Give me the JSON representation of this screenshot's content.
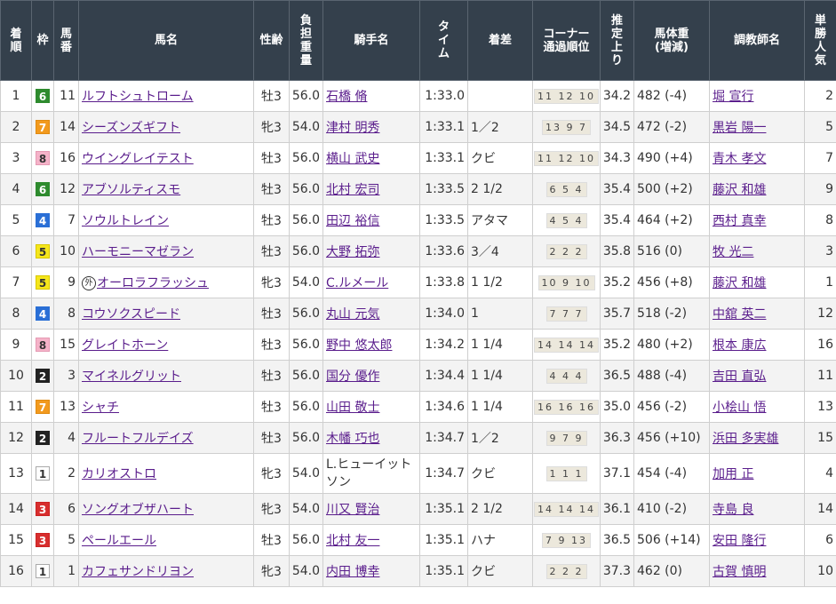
{
  "headers": {
    "rank": "着順",
    "waku": "枠",
    "umaban": "馬番",
    "horse": "馬名",
    "sexage": "性齢",
    "weight": "負担重量",
    "jockey": "騎手名",
    "time": "タイム",
    "margin": "着差",
    "corner": "コーナー通過順位",
    "last3f": "推定上り",
    "bodyweight": "馬体重(増減)",
    "trainer": "調教師名",
    "popularity": "単勝人気"
  },
  "header_lines": {
    "rank": [
      "着",
      "順"
    ],
    "umaban": [
      "馬",
      "番"
    ],
    "weight": [
      "負",
      "担",
      "重",
      "量"
    ],
    "time": [
      "タ",
      "イ",
      "ム"
    ],
    "corner": [
      "コーナー",
      "通過順位"
    ],
    "last3f": [
      "推",
      "定",
      "上",
      "り"
    ],
    "bodyweight": [
      "馬体重",
      "(増減)"
    ],
    "popularity": [
      "単",
      "勝",
      "人",
      "気"
    ]
  },
  "colors": {
    "header_bg": "#34404c",
    "link": "#5a1d8c",
    "waku_1": "#ffffff",
    "waku_2": "#222222",
    "waku_3": "#d72e2e",
    "waku_4": "#2a6fd6",
    "waku_5": "#f5e61c",
    "waku_6": "#2e8b2e",
    "waku_7": "#f29a1e",
    "waku_8": "#f5b3c9"
  },
  "rows": [
    {
      "rank": "1",
      "waku": "6",
      "umaban": "11",
      "mark": "",
      "horse": "ルフトシュトローム",
      "sexage": "牡3",
      "weight": "56.0",
      "jockey": "石橋 脩",
      "time": "1:33.0",
      "margin": "",
      "corner": "11 12 10",
      "last3f": "34.2",
      "bodyweight": "482 (-4)",
      "trainer": "堀 宣行",
      "popularity": "2"
    },
    {
      "rank": "2",
      "waku": "7",
      "umaban": "14",
      "mark": "",
      "horse": "シーズンズギフト",
      "sexage": "牝3",
      "weight": "54.0",
      "jockey": "津村 明秀",
      "time": "1:33.1",
      "margin": "1／2",
      "corner": "13 9 7",
      "last3f": "34.5",
      "bodyweight": "472 (-2)",
      "trainer": "黒岩 陽一",
      "popularity": "5"
    },
    {
      "rank": "3",
      "waku": "8",
      "umaban": "16",
      "mark": "",
      "horse": "ウイングレイテスト",
      "sexage": "牡3",
      "weight": "56.0",
      "jockey": "横山 武史",
      "time": "1:33.1",
      "margin": "クビ",
      "corner": "11 12 10",
      "last3f": "34.3",
      "bodyweight": "490 (+4)",
      "trainer": "青木 孝文",
      "popularity": "7"
    },
    {
      "rank": "4",
      "waku": "6",
      "umaban": "12",
      "mark": "",
      "horse": "アブソルティスモ",
      "sexage": "牡3",
      "weight": "56.0",
      "jockey": "北村 宏司",
      "time": "1:33.5",
      "margin": "2 1/2",
      "corner": "6 5 4",
      "last3f": "35.4",
      "bodyweight": "500 (+2)",
      "trainer": "藤沢 和雄",
      "popularity": "9"
    },
    {
      "rank": "5",
      "waku": "4",
      "umaban": "7",
      "mark": "",
      "horse": "ソウルトレイン",
      "sexage": "牡3",
      "weight": "56.0",
      "jockey": "田辺 裕信",
      "time": "1:33.5",
      "margin": "アタマ",
      "corner": "4 5 4",
      "last3f": "35.4",
      "bodyweight": "464 (+2)",
      "trainer": "西村 真幸",
      "popularity": "8"
    },
    {
      "rank": "6",
      "waku": "5",
      "umaban": "10",
      "mark": "",
      "horse": "ハーモニーマゼラン",
      "sexage": "牡3",
      "weight": "56.0",
      "jockey": "大野 拓弥",
      "time": "1:33.6",
      "margin": "3／4",
      "corner": "2 2 2",
      "last3f": "35.8",
      "bodyweight": "516 (0)",
      "trainer": "牧 光二",
      "popularity": "3"
    },
    {
      "rank": "7",
      "waku": "5",
      "umaban": "9",
      "mark": "外",
      "horse": "オーロラフラッシュ",
      "sexage": "牝3",
      "weight": "54.0",
      "jockey": "C.ルメール",
      "time": "1:33.8",
      "margin": "1 1/2",
      "corner": "10 9 10",
      "last3f": "35.2",
      "bodyweight": "456 (+8)",
      "trainer": "藤沢 和雄",
      "popularity": "1"
    },
    {
      "rank": "8",
      "waku": "4",
      "umaban": "8",
      "mark": "",
      "horse": "コウソクスピード",
      "sexage": "牡3",
      "weight": "56.0",
      "jockey": "丸山 元気",
      "time": "1:34.0",
      "margin": "1",
      "corner": "7 7 7",
      "last3f": "35.7",
      "bodyweight": "518 (-2)",
      "trainer": "中舘 英二",
      "popularity": "12"
    },
    {
      "rank": "9",
      "waku": "8",
      "umaban": "15",
      "mark": "",
      "horse": "グレイトホーン",
      "sexage": "牡3",
      "weight": "56.0",
      "jockey": "野中 悠太郎",
      "time": "1:34.2",
      "margin": "1 1/4",
      "corner": "14 14 14",
      "last3f": "35.2",
      "bodyweight": "480 (+2)",
      "trainer": "根本 康広",
      "popularity": "16"
    },
    {
      "rank": "10",
      "waku": "2",
      "umaban": "3",
      "mark": "",
      "horse": "マイネルグリット",
      "sexage": "牡3",
      "weight": "56.0",
      "jockey": "国分 優作",
      "time": "1:34.4",
      "margin": "1 1/4",
      "corner": "4 4 4",
      "last3f": "36.5",
      "bodyweight": "488 (-4)",
      "trainer": "吉田 直弘",
      "popularity": "11"
    },
    {
      "rank": "11",
      "waku": "7",
      "umaban": "13",
      "mark": "",
      "horse": "シャチ",
      "sexage": "牡3",
      "weight": "56.0",
      "jockey": "山田 敬士",
      "time": "1:34.6",
      "margin": "1 1/4",
      "corner": "16 16 16",
      "last3f": "35.0",
      "bodyweight": "456 (-2)",
      "trainer": "小桧山 悟",
      "popularity": "13"
    },
    {
      "rank": "12",
      "waku": "2",
      "umaban": "4",
      "mark": "",
      "horse": "フルートフルデイズ",
      "sexage": "牡3",
      "weight": "56.0",
      "jockey": "木幡 巧也",
      "time": "1:34.7",
      "margin": "1／2",
      "corner": "9 7 9",
      "last3f": "36.3",
      "bodyweight": "456 (+10)",
      "trainer": "浜田 多実雄",
      "popularity": "15"
    },
    {
      "rank": "13",
      "waku": "1",
      "umaban": "2",
      "mark": "",
      "horse": "カリオストロ",
      "sexage": "牝3",
      "weight": "54.0",
      "jockey": "L.ヒューイットソン",
      "time": "1:34.7",
      "margin": "クビ",
      "corner": "1 1 1",
      "last3f": "37.1",
      "bodyweight": "454 (-4)",
      "trainer": "加用 正",
      "popularity": "4"
    },
    {
      "rank": "14",
      "waku": "3",
      "umaban": "6",
      "mark": "",
      "horse": "ソングオブザハート",
      "sexage": "牝3",
      "weight": "54.0",
      "jockey": "川又 賢治",
      "time": "1:35.1",
      "margin": "2 1/2",
      "corner": "14 14 14",
      "last3f": "36.1",
      "bodyweight": "410 (-2)",
      "trainer": "寺島 良",
      "popularity": "14"
    },
    {
      "rank": "15",
      "waku": "3",
      "umaban": "5",
      "mark": "",
      "horse": "ペールエール",
      "sexage": "牡3",
      "weight": "56.0",
      "jockey": "北村 友一",
      "time": "1:35.1",
      "margin": "ハナ",
      "corner": "7 9 13",
      "last3f": "36.5",
      "bodyweight": "506 (+14)",
      "trainer": "安田 隆行",
      "popularity": "6"
    },
    {
      "rank": "16",
      "waku": "1",
      "umaban": "1",
      "mark": "",
      "horse": "カフェサンドリヨン",
      "sexage": "牝3",
      "weight": "54.0",
      "jockey": "内田 博幸",
      "time": "1:35.1",
      "margin": "クビ",
      "corner": "2 2 2",
      "last3f": "37.3",
      "bodyweight": "462 (0)",
      "trainer": "古賀 慎明",
      "popularity": "10"
    }
  ]
}
